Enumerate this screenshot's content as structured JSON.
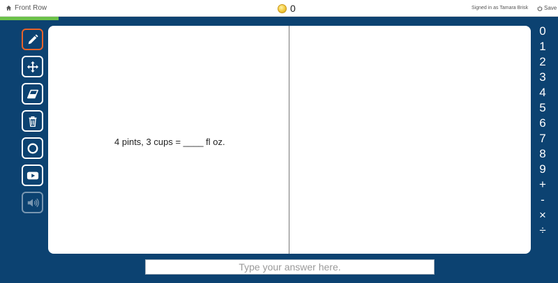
{
  "header": {
    "brand_label": "Front Row",
    "coin_count": "0",
    "signed_in": "Signed in as Tamara Brisk",
    "save_label": "Save &"
  },
  "progress": {
    "fraction": 0.105,
    "color": "#6cc24a"
  },
  "toolbar": {
    "tools": [
      "pencil-icon",
      "move-icon",
      "eraser-icon",
      "trash-icon",
      "circle-icon",
      "video-icon",
      "speaker-icon"
    ],
    "active_color": "#e8632a"
  },
  "question": {
    "text": "4 pints, 3 cups = ____ fl oz."
  },
  "keypad": {
    "keys": [
      "0",
      "1",
      "2",
      "3",
      "4",
      "5",
      "6",
      "7",
      "8",
      "9",
      "+",
      "-",
      "×",
      "÷"
    ]
  },
  "answer": {
    "placeholder": "Type your answer here.",
    "value": ""
  },
  "colors": {
    "background": "#0c4271",
    "panel": "#ffffff"
  }
}
